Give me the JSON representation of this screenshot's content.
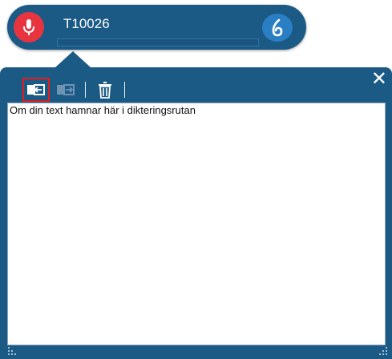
{
  "dictation_bar": {
    "title": "T10026"
  },
  "dictation_box": {
    "text": "Om din text hamnar här i dikteringsrutan",
    "close_glyph": "✕"
  },
  "icons": {
    "mic": "microphone-icon",
    "dragon": "dragon-flame-icon",
    "transfer": "transfer-text-icon",
    "transfer_disabled": "transfer-text-disabled-icon",
    "trash": "trash-icon"
  },
  "colors": {
    "bar_background": "#1c5a86",
    "mic_button": "#e8343f",
    "dragon_button": "#2a7fc4",
    "selection_highlight": "#e01e1e"
  }
}
